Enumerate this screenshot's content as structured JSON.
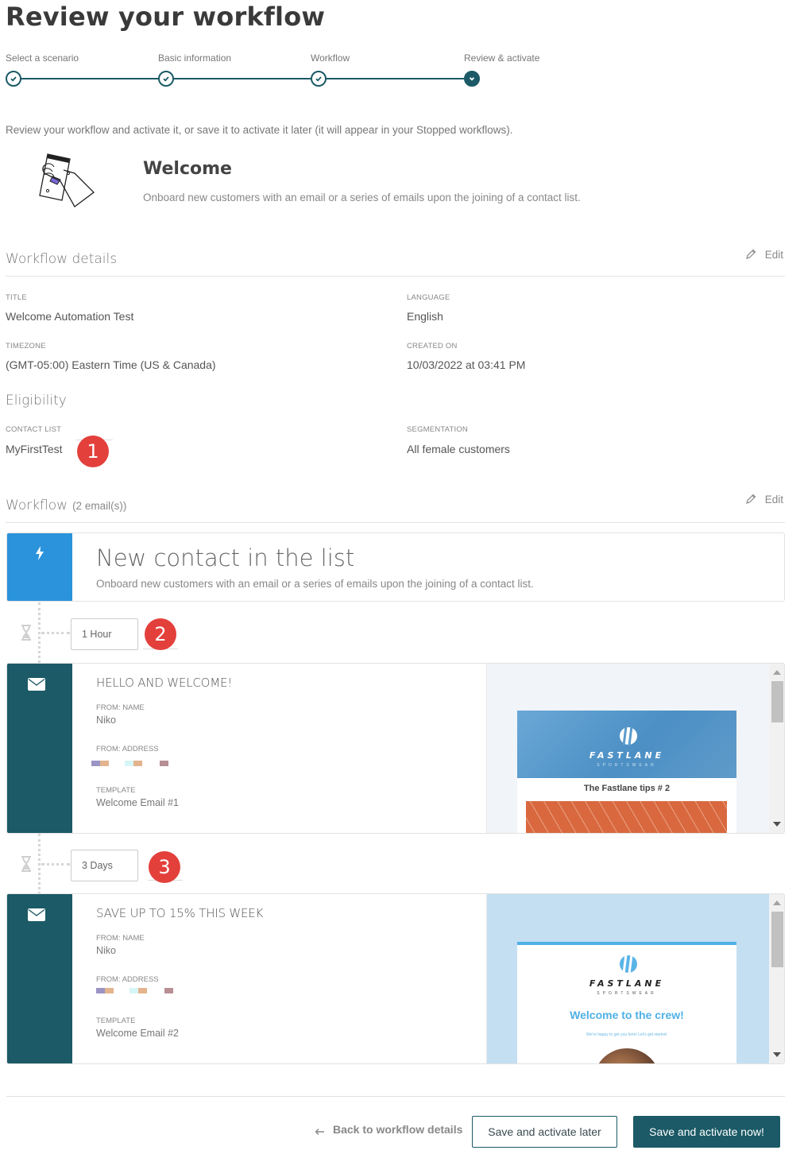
{
  "page": {
    "title": "Review your workflow",
    "intro": "Review your workflow and activate it, or save it to activate it later (it will appear in your Stopped workflows)."
  },
  "stepper": {
    "steps": [
      {
        "label": "Select a scenario",
        "state": "completed",
        "icon": "check-icon"
      },
      {
        "label": "Basic information",
        "state": "completed",
        "icon": "check-icon"
      },
      {
        "label": "Workflow",
        "state": "completed",
        "icon": "check-icon"
      },
      {
        "label": "Review & activate",
        "state": "active",
        "icon": "chevron-down-icon"
      }
    ]
  },
  "scenario": {
    "icon": "hand-holding-phone-illustration",
    "title": "Welcome",
    "description": "Onboard new customers with an email or a series of emails upon the joining of a contact list."
  },
  "workflow_details": {
    "section_title": "Workflow details",
    "edit_label": "Edit",
    "fields": {
      "title": {
        "label": "TITLE",
        "value": "Welcome Automation Test"
      },
      "language": {
        "label": "LANGUAGE",
        "value": "English"
      },
      "timezone": {
        "label": "TIMEZONE",
        "value": "(GMT-05:00) Eastern Time (US & Canada)"
      },
      "created_on": {
        "label": "CREATED ON",
        "value": "10/03/2022 at 03:41 PM"
      }
    }
  },
  "eligibility": {
    "section_title": "Eligibility",
    "contact_list": {
      "label": "CONTACT LIST",
      "value": "MyFirstTest"
    },
    "segmentation": {
      "label": "SEGMENTATION",
      "value": "All female customers"
    }
  },
  "workflow": {
    "section_title": "Workflow",
    "count": "(2 email(s))",
    "edit_label": "Edit",
    "trigger": {
      "icon": "lightning-icon",
      "title": "New contact in the list",
      "description": "Onboard new customers with an email or a series of emails upon the joining of a contact list."
    },
    "delays": [
      {
        "value": "1 Hour"
      },
      {
        "value": "3 Days"
      }
    ],
    "emails": [
      {
        "subject": "HELLO AND WELCOME!",
        "from_name_label": "FROM: NAME",
        "from_name": "Niko",
        "from_address_label": "FROM: ADDRESS",
        "template_label": "TEMPLATE",
        "template": "Welcome Email #1",
        "preview": {
          "brand": "FASTLANE",
          "brand_sub": "SPORTSWEAR",
          "heading": "The Fastlane tips # 2"
        }
      },
      {
        "subject": "SAVE UP TO 15% THIS WEEK",
        "from_name_label": "FROM: NAME",
        "from_name": "Niko",
        "from_address_label": "FROM: ADDRESS",
        "template_label": "TEMPLATE",
        "template": "Welcome Email #2",
        "preview": {
          "brand": "FASTLANE",
          "brand_sub": "SPORTSWEAR",
          "heading": "Welcome to the crew!",
          "subheading": "We're happy to get you here! Let's get started:"
        }
      }
    ]
  },
  "annotations": {
    "badges": [
      "1",
      "2",
      "3"
    ],
    "color": "#e3403c"
  },
  "footer": {
    "back_label": "Back to workflow details",
    "save_later_label": "Save and activate later",
    "save_now_label": "Save and activate now!"
  },
  "colors": {
    "primary": "#1b5a66",
    "trigger": "#2b93dc",
    "badge": "#e3403c"
  }
}
